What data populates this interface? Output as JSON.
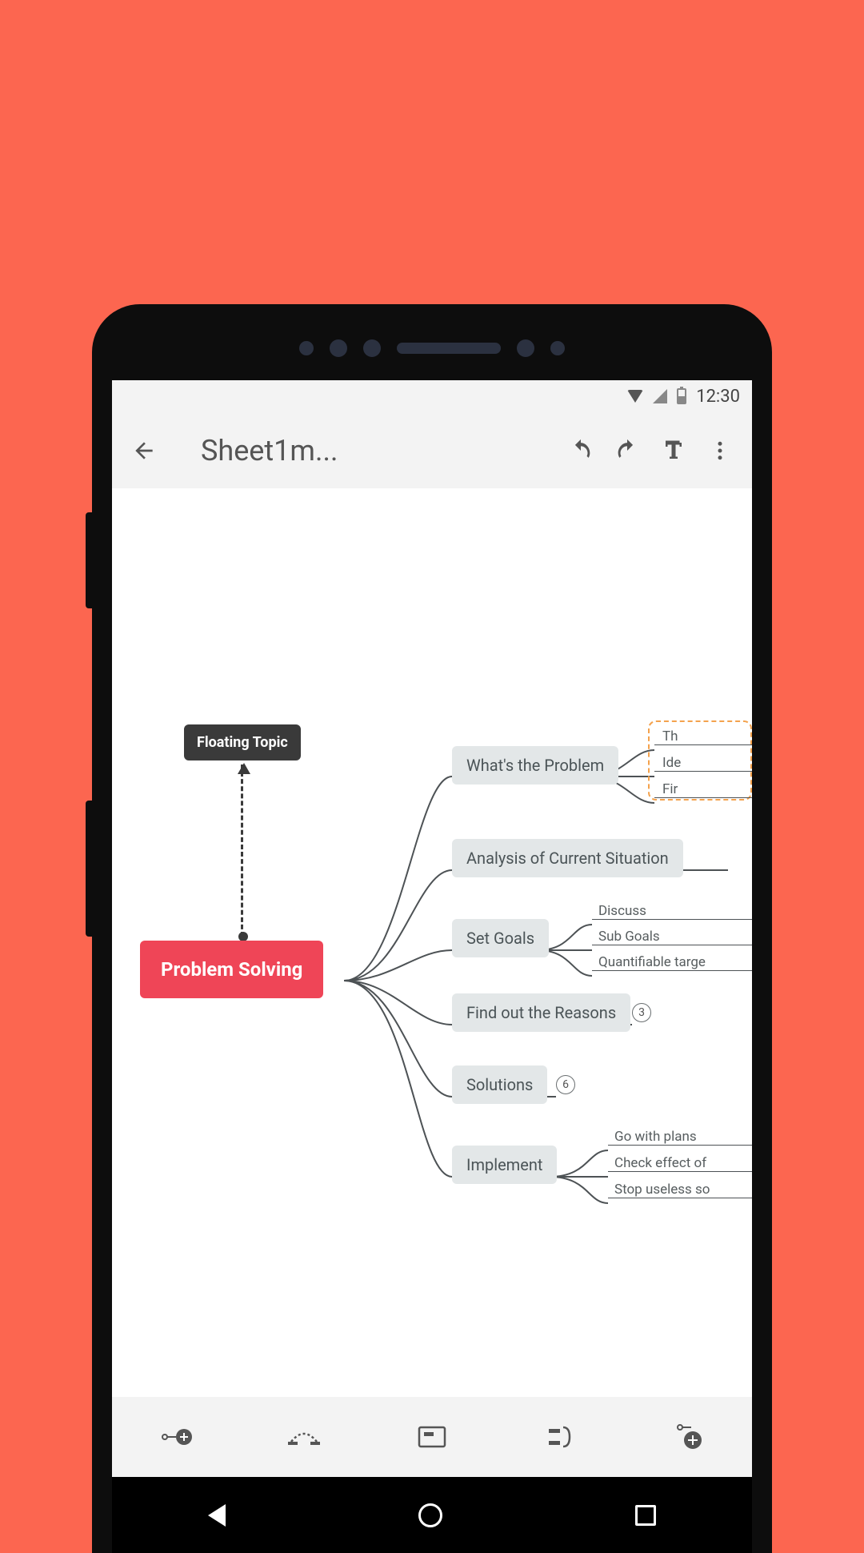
{
  "status": {
    "time": "12:30"
  },
  "appbar": {
    "title": "Sheet1m..."
  },
  "mindmap": {
    "floating": "Floating Topic",
    "root": "Problem Solving",
    "branches": [
      {
        "label": "What's the Problem",
        "children": [
          "Th",
          "Ide",
          "Fir"
        ]
      },
      {
        "label": "Analysis of Current Situation",
        "children": []
      },
      {
        "label": "Set Goals",
        "children": [
          "Discuss",
          "Sub Goals",
          "Quantifiable targe"
        ]
      },
      {
        "label": "Find out the Reasons",
        "badge": "3"
      },
      {
        "label": "Solutions",
        "badge": "6"
      },
      {
        "label": "Implement",
        "children": [
          "Go with plans",
          "Check effect of",
          "Stop useless so"
        ]
      }
    ]
  }
}
